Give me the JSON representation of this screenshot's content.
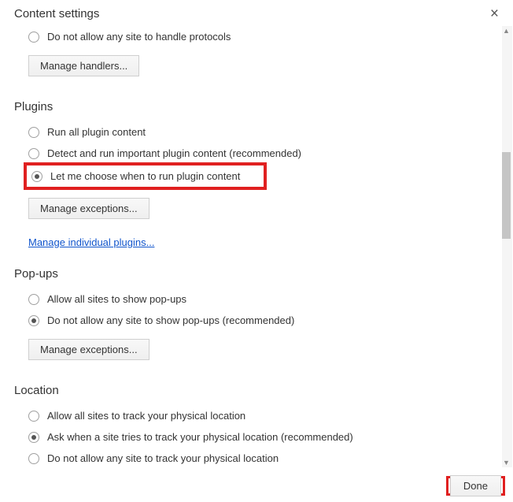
{
  "header": {
    "title": "Content settings"
  },
  "protocols": {
    "opt_block": "Do not allow any site to handle protocols",
    "manage_btn": "Manage handlers..."
  },
  "plugins": {
    "title": "Plugins",
    "opt_run_all": "Run all plugin content",
    "opt_detect": "Detect and run important plugin content (recommended)",
    "opt_choose": "Let me choose when to run plugin content",
    "manage_btn": "Manage exceptions...",
    "link": "Manage individual plugins..."
  },
  "popups": {
    "title": "Pop-ups",
    "opt_allow": "Allow all sites to show pop-ups",
    "opt_block": "Do not allow any site to show pop-ups (recommended)",
    "manage_btn": "Manage exceptions..."
  },
  "location": {
    "title": "Location",
    "opt_allow": "Allow all sites to track your physical location",
    "opt_ask": "Ask when a site tries to track your physical location (recommended)",
    "opt_block": "Do not allow any site to track your physical location"
  },
  "footer": {
    "done": "Done"
  }
}
